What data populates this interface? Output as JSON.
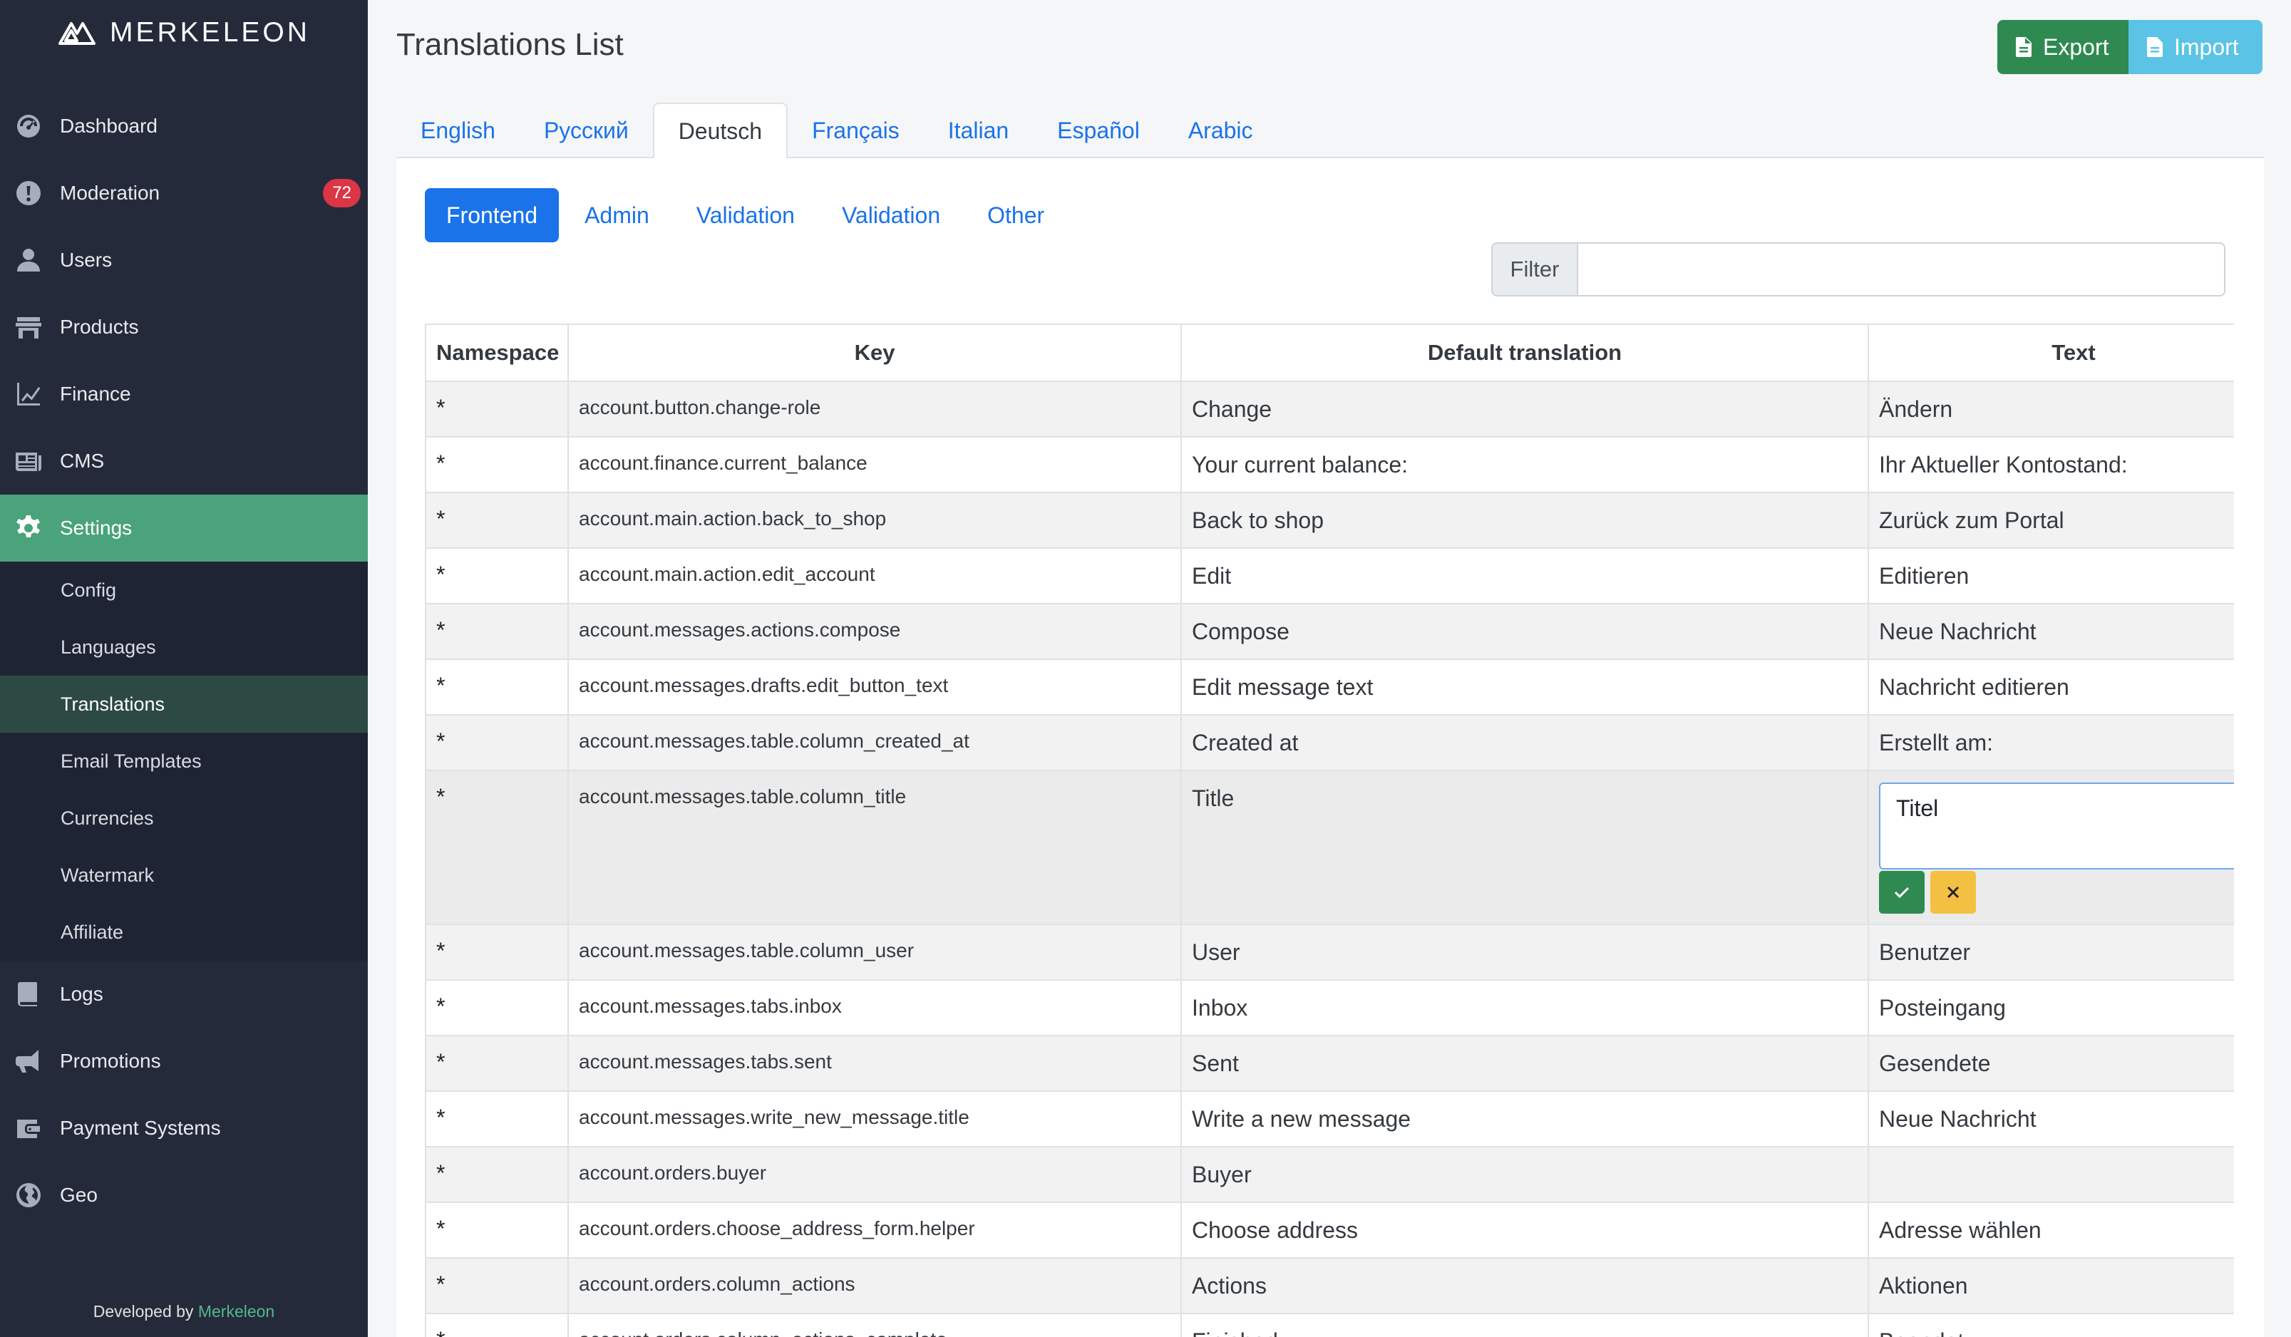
{
  "brand": {
    "name": "MERKELEON"
  },
  "sidebar": {
    "items": [
      {
        "label": "Dashboard",
        "icon": "dashboard-icon"
      },
      {
        "label": "Moderation",
        "icon": "alert-icon",
        "badge": "72"
      },
      {
        "label": "Users",
        "icon": "user-icon"
      },
      {
        "label": "Products",
        "icon": "store-icon"
      },
      {
        "label": "Finance",
        "icon": "chart-icon"
      },
      {
        "label": "CMS",
        "icon": "newspaper-icon"
      },
      {
        "label": "Settings",
        "icon": "gear-icon",
        "active": true
      }
    ],
    "settings_children": [
      "Config",
      "Languages",
      "Translations",
      "Email Templates",
      "Currencies",
      "Watermark",
      "Affiliate"
    ],
    "active_child": "Translations",
    "items_after": [
      {
        "label": "Logs",
        "icon": "book-icon"
      },
      {
        "label": "Promotions",
        "icon": "megaphone-icon"
      },
      {
        "label": "Payment Systems",
        "icon": "wallet-icon"
      },
      {
        "label": "Geo",
        "icon": "globe-icon"
      }
    ],
    "footer_prefix": "Developed by",
    "footer_link": "Merkeleon"
  },
  "header": {
    "title": "Translations List",
    "export_label": "Export",
    "import_label": "Import"
  },
  "language_tabs": [
    "English",
    "Русский",
    "Deutsch",
    "Français",
    "Italian",
    "Español",
    "Arabic"
  ],
  "active_language": "Deutsch",
  "section_tabs": [
    "Frontend",
    "Admin",
    "Validation",
    "Validation",
    "Other"
  ],
  "active_section": "Frontend",
  "filter": {
    "label": "Filter",
    "value": ""
  },
  "table": {
    "columns": [
      "Namespace",
      "Key",
      "Default translation",
      "Text"
    ],
    "rows": [
      {
        "ns": "*",
        "key": "account.button.change-role",
        "def": "Change",
        "text": "Ändern"
      },
      {
        "ns": "*",
        "key": "account.finance.current_balance",
        "def": "Your current balance:",
        "text": "Ihr Aktueller Kontostand:"
      },
      {
        "ns": "*",
        "key": "account.main.action.back_to_shop",
        "def": "Back to shop",
        "text": "Zurück zum Portal"
      },
      {
        "ns": "*",
        "key": "account.main.action.edit_account",
        "def": "Edit",
        "text": "Editieren"
      },
      {
        "ns": "*",
        "key": "account.messages.actions.compose",
        "def": "Compose",
        "text": "Neue Nachricht"
      },
      {
        "ns": "*",
        "key": "account.messages.drafts.edit_button_text",
        "def": "Edit message text",
        "text": "Nachricht editieren"
      },
      {
        "ns": "*",
        "key": "account.messages.table.column_created_at",
        "def": "Created at",
        "text": "Erstellt am:"
      },
      {
        "ns": "*",
        "key": "account.messages.table.column_title",
        "def": "Title",
        "text": "Titel",
        "editing": true
      },
      {
        "ns": "*",
        "key": "account.messages.table.column_user",
        "def": "User",
        "text": "Benutzer"
      },
      {
        "ns": "*",
        "key": "account.messages.tabs.inbox",
        "def": "Inbox",
        "text": "Posteingang"
      },
      {
        "ns": "*",
        "key": "account.messages.tabs.sent",
        "def": "Sent",
        "text": "Gesendete"
      },
      {
        "ns": "*",
        "key": "account.messages.write_new_message.title",
        "def": "Write a new message",
        "text": "Neue Nachricht"
      },
      {
        "ns": "*",
        "key": "account.orders.buyer",
        "def": "Buyer",
        "text": ""
      },
      {
        "ns": "*",
        "key": "account.orders.choose_address_form.helper",
        "def": "Choose address",
        "text": "Adresse wählen"
      },
      {
        "ns": "*",
        "key": "account.orders.column_actions",
        "def": "Actions",
        "text": "Aktionen"
      },
      {
        "ns": "*",
        "key": "account.orders.column_actions_complete",
        "def": "Finished",
        "text": "Beendet"
      }
    ]
  }
}
